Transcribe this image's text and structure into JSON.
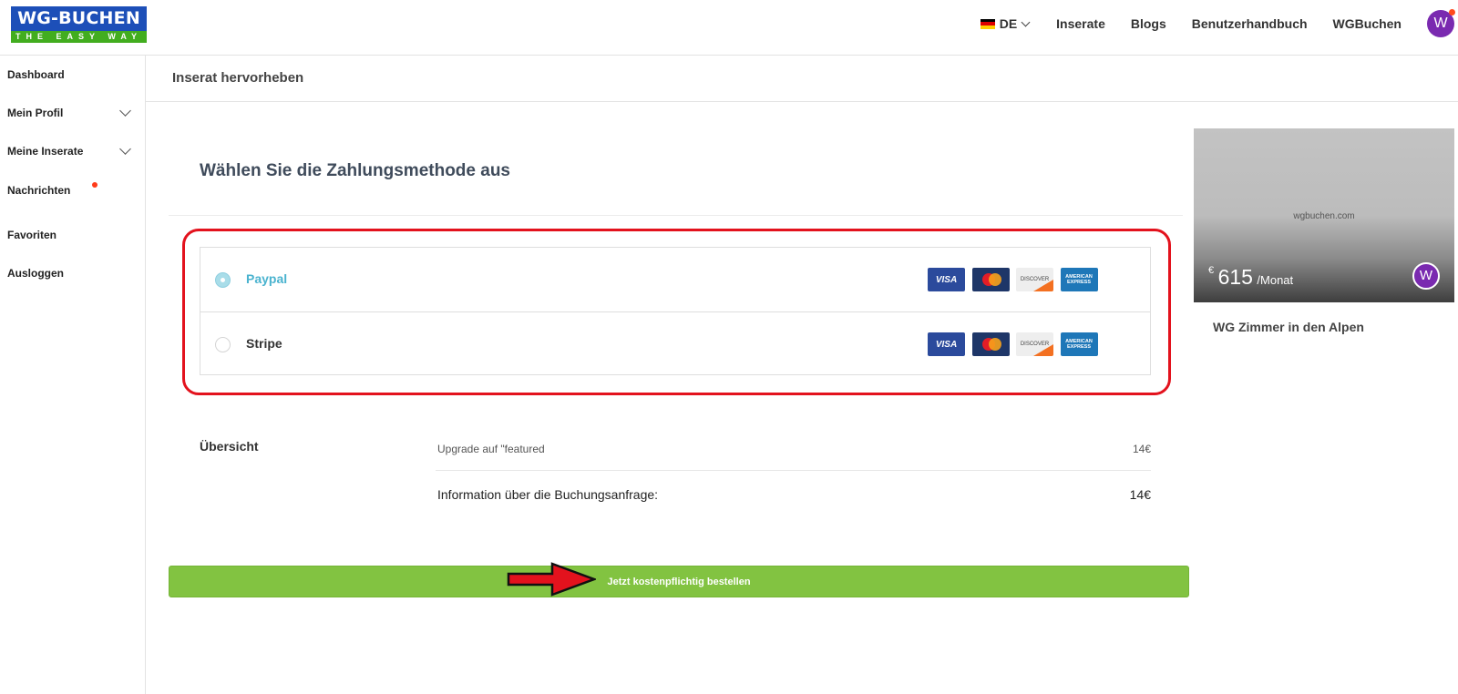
{
  "header": {
    "logo_line1": "WG-BUCHEN",
    "logo_line2": "THE EASY WAY",
    "language": "DE",
    "nav": [
      "Inserate",
      "Blogs",
      "Benutzerhandbuch",
      "WGBuchen"
    ],
    "avatar_letter": "W",
    "colors": {
      "logo_blue": "#1d4fb8",
      "logo_green": "#42ad1f",
      "avatar": "#7a2ab0"
    }
  },
  "sidebar": {
    "items": [
      {
        "label": "Dashboard"
      },
      {
        "label": "Mein Profil"
      },
      {
        "label": "Meine Inserate"
      },
      {
        "label": "Nachrichten"
      },
      {
        "label": "Favoriten"
      },
      {
        "label": "Ausloggen"
      }
    ]
  },
  "subheader": {
    "title": "Inserat hervorheben"
  },
  "payment": {
    "title": "Wählen Sie die Zahlungsmethode aus",
    "methods": [
      {
        "label": "Paypal",
        "selected": true
      },
      {
        "label": "Stripe",
        "selected": false
      }
    ],
    "card_icons": [
      "visa-icon",
      "mastercard-icon",
      "discover-icon",
      "amex-icon"
    ],
    "card_text": {
      "visa": "VISA",
      "discover": "DISCOVER",
      "amex": "AMERICAN EXPRESS"
    }
  },
  "overview": {
    "title": "Übersicht",
    "line1_label": "Upgrade auf \"featured",
    "line1_price": "14€",
    "line2_label": "Information über die Buchungsanfrage:",
    "line2_price": "14€"
  },
  "order_button": {
    "label": "Jetzt kostenpflichtig bestellen",
    "color": "#82c341"
  },
  "listing": {
    "watermark": "wgbuchen.com",
    "currency": "€",
    "price": "615",
    "period": "/Monat",
    "avatar_letter": "W",
    "title": "WG Zimmer in den Alpen"
  }
}
